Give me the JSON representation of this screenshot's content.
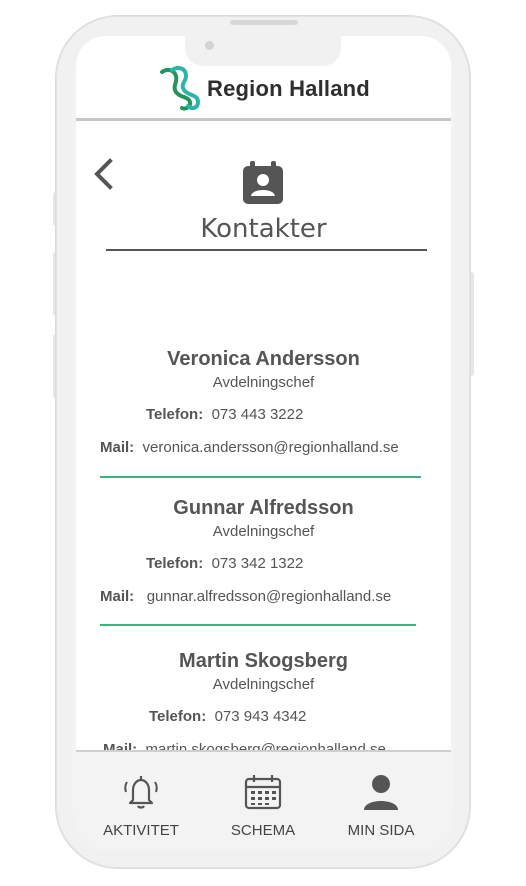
{
  "app": {
    "brand": "Region Halland",
    "logo_icon": "region-halland-logo-icon"
  },
  "header": {
    "back_icon": "chevron-left-icon",
    "page_icon": "contact-card-icon",
    "title": "Kontakter"
  },
  "contacts": [
    {
      "name": "Veronica Andersson",
      "role": "Avdelningschef",
      "phone_label": "Telefon:",
      "phone": "073 443 3222",
      "mail_label": "Mail:",
      "mail": "veronica.andersson@regionhalland.se"
    },
    {
      "name": "Gunnar Alfredsson",
      "role": "Avdelningschef",
      "phone_label": "Telefon:",
      "phone": "073 342 1322",
      "mail_label": "Mail:",
      "mail": "gunnar.alfredsson@regionhalland.se"
    },
    {
      "name": "Martin Skogsberg",
      "role": "Avdelningschef",
      "phone_label": "Telefon:",
      "phone": "073 943 4342",
      "mail_label": "Mail:",
      "mail": "martin.skogsberg@regionhalland.se"
    }
  ],
  "bottom_nav": [
    {
      "label": "AKTIVITET",
      "icon": "bell-icon"
    },
    {
      "label": "SCHEMA",
      "icon": "calendar-icon"
    },
    {
      "label": "MIN SIDA",
      "icon": "user-icon"
    }
  ],
  "colors": {
    "accent": "#3fb37f",
    "text": "#555555",
    "logo_teal": "#2bb5a6",
    "logo_green": "#23945c"
  }
}
